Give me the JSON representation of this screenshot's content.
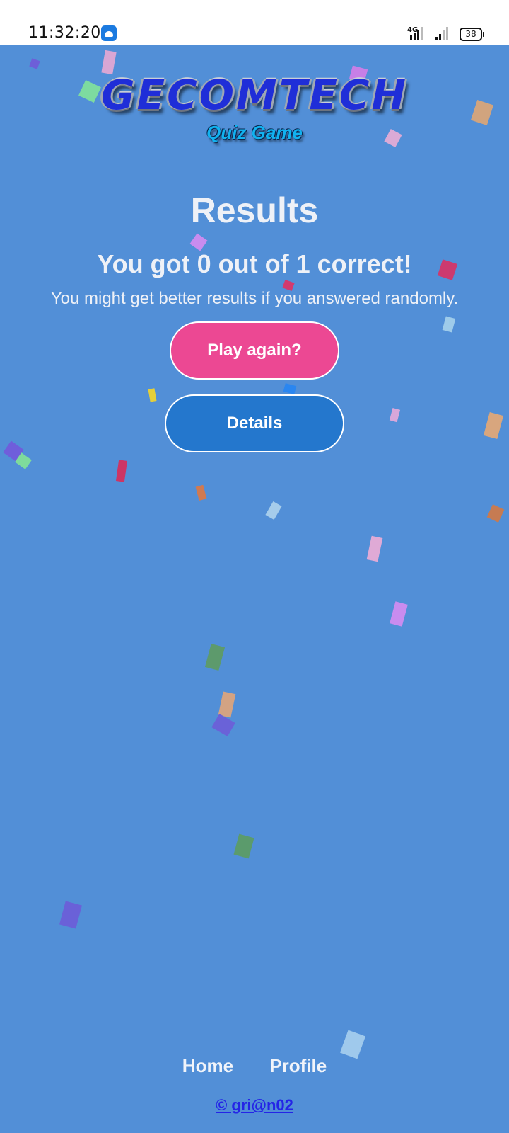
{
  "status_bar": {
    "time": "11:32:20",
    "network": "4G",
    "battery": "38"
  },
  "header": {
    "logo": "GECOMTECH",
    "subtitle": "Quiz Game"
  },
  "results": {
    "title": "Results",
    "score_text": "You got 0 out of 1 correct!",
    "comment": "You might get better results if you answered randomly."
  },
  "buttons": {
    "play_again": "Play again?",
    "details": "Details"
  },
  "footer": {
    "nav": [
      "Home",
      "Profile"
    ],
    "copyright": "© gri@n02"
  },
  "colors": {
    "background": "#528fd7",
    "play_button": "#ec4893",
    "details_button": "#2477cd",
    "copyright_link": "#2424e6"
  }
}
